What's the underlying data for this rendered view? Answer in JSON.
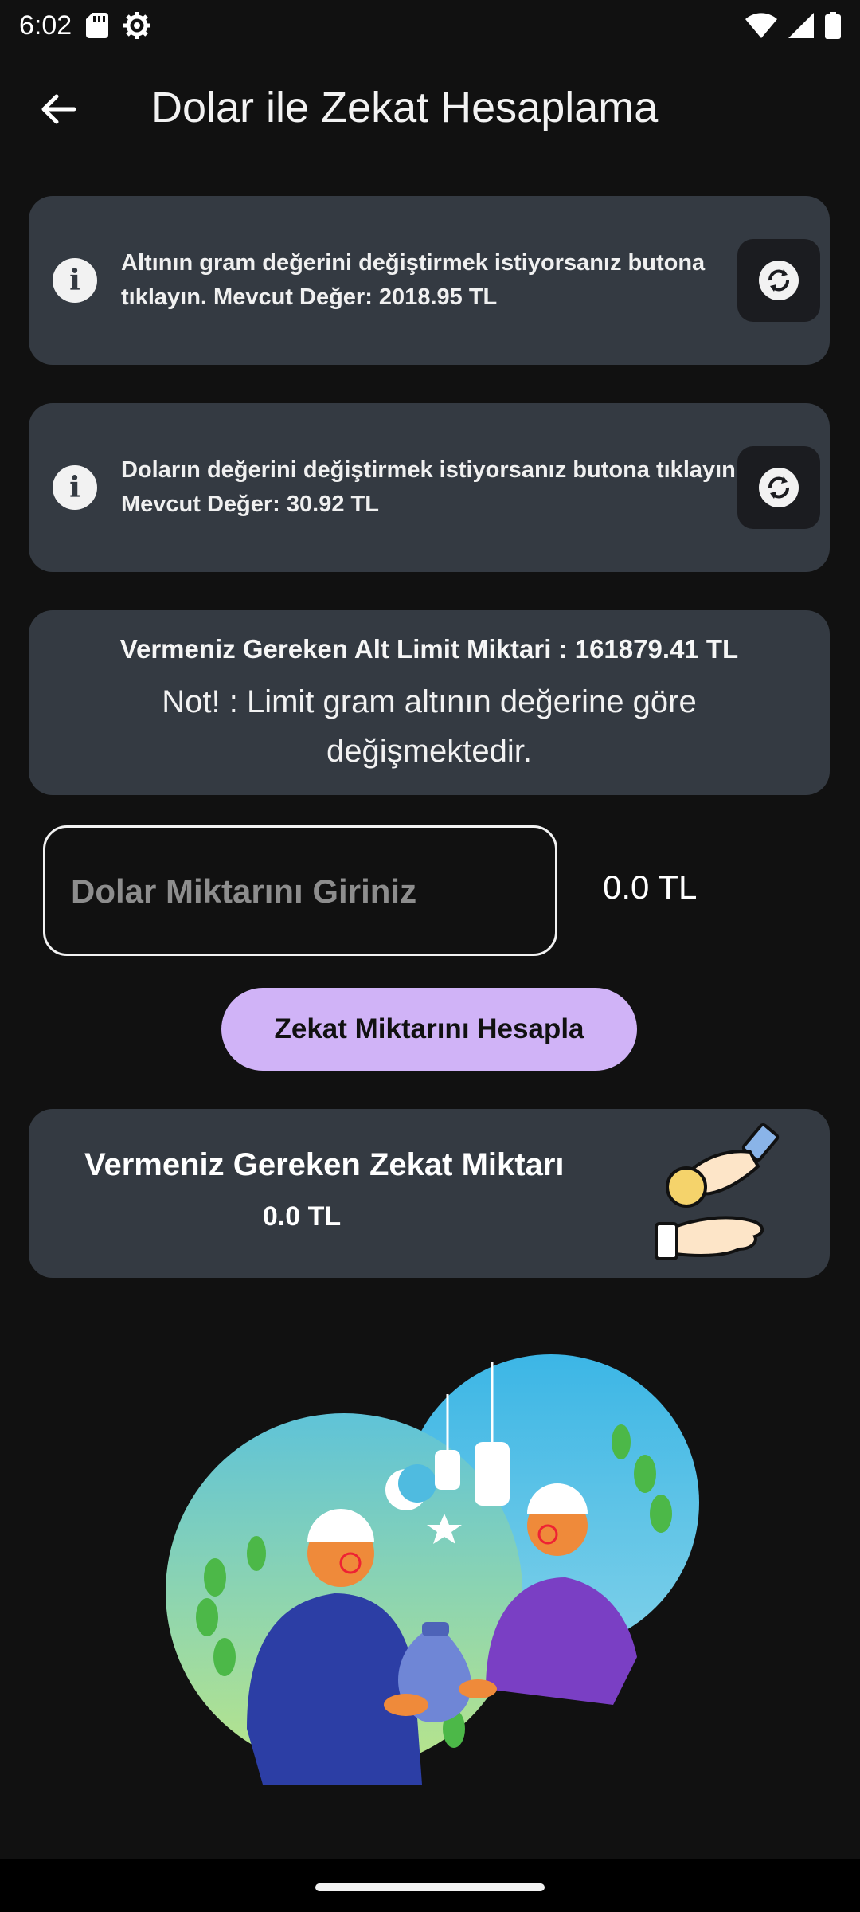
{
  "status_bar": {
    "time": "6:02"
  },
  "app_bar": {
    "title": "Dolar ile Zekat Hesaplama"
  },
  "gold_card": {
    "text": "Altının gram değerini değiştirmek istiyorsanız butona tıklayın. Mevcut Değer: 2018.95 TL"
  },
  "dollar_card": {
    "text": "Doların değerini değiştirmek istiyorsanız butona tıklayın. Mevcut Değer: 30.92 TL"
  },
  "limit_card": {
    "title": "Vermeniz Gereken Alt Limit Miktari : 161879.41 TL",
    "note": "Not! : Limit gram altının değerine göre değişmektedir."
  },
  "input": {
    "placeholder": "Dolar Miktarını Giriniz",
    "converted_value": "0.0 TL"
  },
  "calculate_button": {
    "label": "Zekat Miktarını Hesapla"
  },
  "zekat_card": {
    "title": "Vermeniz Gereken Zekat Miktarı",
    "value": "0.0 TL"
  }
}
